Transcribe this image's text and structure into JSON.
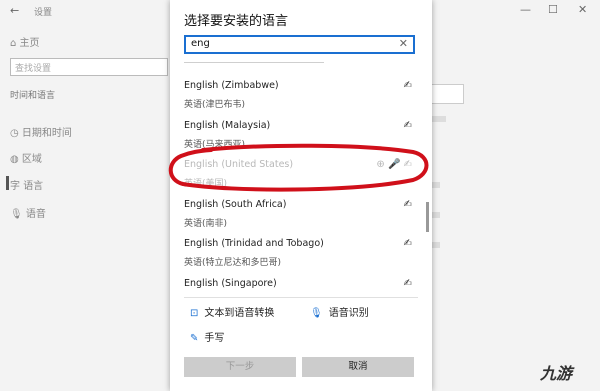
{
  "background": {
    "app_title": "设置",
    "home": "主页",
    "search_placeholder": "查找设置",
    "section": "时间和语言",
    "nav": [
      "日期和时间",
      "区域",
      "语言",
      "语音"
    ]
  },
  "dialog": {
    "title": "选择要安装的语言",
    "search_value": "eng",
    "languages": [
      {
        "name": "English (Zimbabwe)",
        "native": "英语(津巴布韦)",
        "icons": "✍",
        "dim": false
      },
      {
        "name": "English (Malaysia)",
        "native": "英语(马来西亚)",
        "icons": "✍",
        "dim": false
      },
      {
        "name": "English (United States)",
        "native": "英语(美国)",
        "icons": "⊕  🎤  ✍",
        "dim": true
      },
      {
        "name": "English (South Africa)",
        "native": "英语(南非)",
        "icons": "✍",
        "dim": false
      },
      {
        "name": "English (Trinidad and Tobago)",
        "native": "英语(特立尼达和多巴哥)",
        "icons": "✍",
        "dim": false
      },
      {
        "name": "English (Singapore)",
        "native": "",
        "icons": "✍",
        "dim": false
      }
    ],
    "features": {
      "tts": "文本到语音转换",
      "speech": "语音识别",
      "handwriting": "手写"
    },
    "next_label": "下一步",
    "cancel_label": "取消"
  },
  "watermark": "九游",
  "colors": {
    "accent": "#1a6fd1",
    "highlight_oval": "#d0101a"
  }
}
